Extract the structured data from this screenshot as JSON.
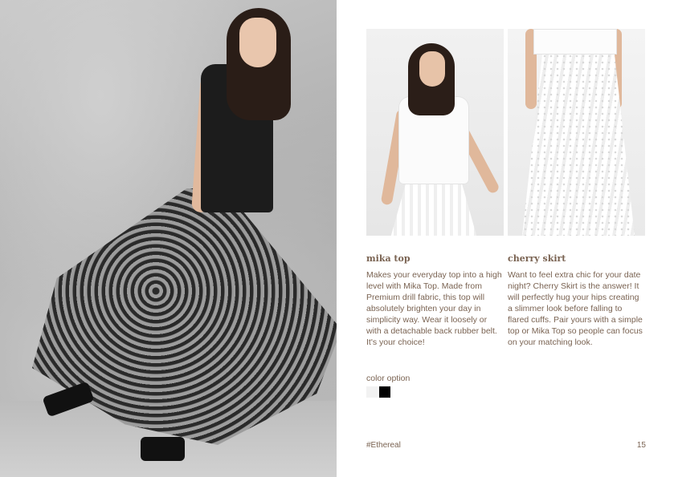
{
  "products": [
    {
      "name": "mika top",
      "description": "Makes your everyday top into a high level with Mika Top. Made from Premium drill fabric, this top will absolutely brighten your day in simplicity way. Wear it loosely or with a detachable back rubber belt. It's your choice!"
    },
    {
      "name": "cherry skirt",
      "description": "Want to feel extra chic for your date night? Cherry Skirt is the answer! It will perfectly hug your hips creating a slimmer look before falling to flared cuffs. Pair yours with a simple top or Mika Top so people can focus on your matching look."
    }
  ],
  "color_option": {
    "label": "color option",
    "swatches": [
      "#f2f2f2",
      "#000000"
    ]
  },
  "footer": {
    "tag": "#Ethereal",
    "page_number": "15"
  },
  "colors": {
    "text": "#7a6352",
    "background": "#ffffff"
  }
}
